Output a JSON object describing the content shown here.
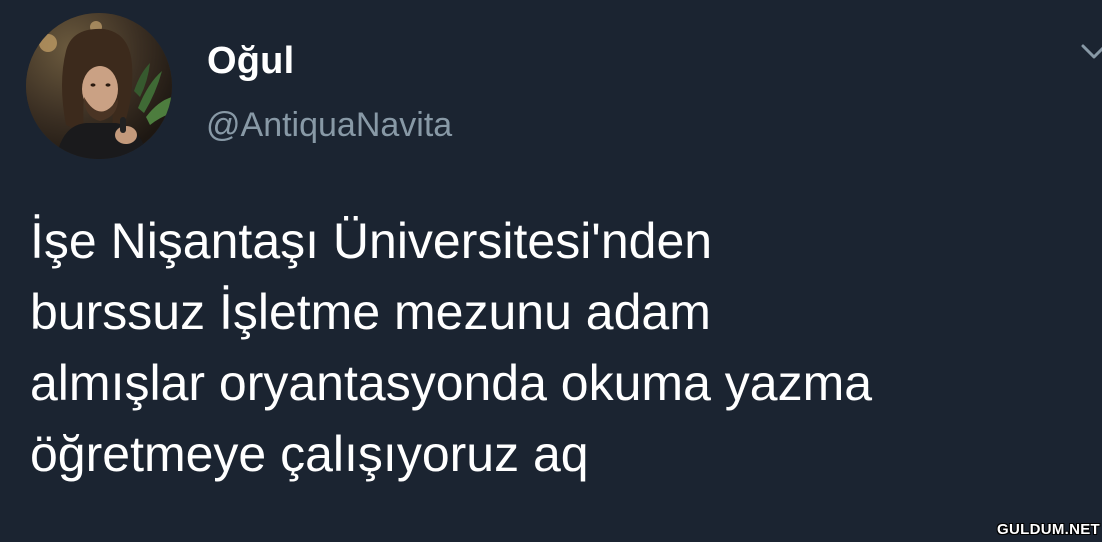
{
  "tweet": {
    "display_name": "Oğul",
    "handle": "@AntiquaNavita",
    "text_lines": [
      "İşe Nişantaşı Üniversitesi'nden",
      "burssuz İşletme mezunu adam",
      "almışlar oryantasyonda okuma yazma",
      "öğretmeye çalışıyoruz aq"
    ],
    "menu_icon": "chevron-down-icon",
    "avatar_icon": "profile-photo"
  },
  "watermark": {
    "text": "GULDUM.NET"
  },
  "colors": {
    "background": "#1b2431",
    "primary_text": "#ffffff",
    "secondary_text": "#8899a6"
  }
}
